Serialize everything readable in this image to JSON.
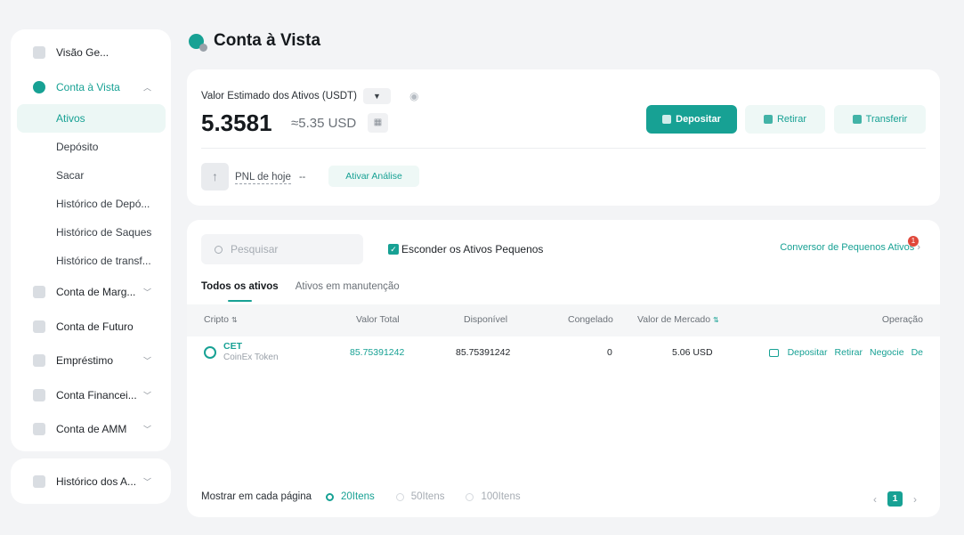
{
  "sidebar": {
    "items": [
      {
        "label": "Visão Ge...",
        "icon": "overview-icon"
      },
      {
        "label": "Conta à Vista",
        "icon": "spot-account-icon",
        "active": true,
        "expanded": true
      },
      {
        "label": "Conta de Marg...",
        "icon": "margin-icon"
      },
      {
        "label": "Conta de Futuro",
        "icon": "futures-icon"
      },
      {
        "label": "Empréstimo",
        "icon": "loan-icon"
      },
      {
        "label": "Conta Financei...",
        "icon": "financial-icon"
      },
      {
        "label": "Conta de AMM",
        "icon": "amm-icon"
      }
    ],
    "subitems": [
      "Ativos",
      "Depósito",
      "Sacar",
      "Histórico de Depó...",
      "Histórico de Saques",
      "Histórico de transf..."
    ],
    "history": "Histórico dos A..."
  },
  "page_title": "Conta à Vista",
  "summary": {
    "est_label": "Valor Estimado dos Ativos (USDT)",
    "value": "5.3581",
    "approx": "≈5.35 USD",
    "deposit": "Depositar",
    "withdraw": "Retirar",
    "transfer": "Transferir",
    "pnl_label": "PNL de hoje",
    "pnl_value": "--",
    "activate": "Ativar Análise"
  },
  "assets": {
    "search_placeholder": "Pesquisar",
    "hide_small": "Esconder os Ativos Pequenos",
    "converter": "Conversor de Pequenos Ativos",
    "converter_badge": "1",
    "tabs": [
      "Todos os ativos",
      "Ativos em manutenção"
    ],
    "columns": [
      "Cripto",
      "Valor Total",
      "Disponível",
      "Congelado",
      "Valor de Mercado",
      "Operação"
    ],
    "rows": [
      {
        "coin": "CET",
        "name": "CoinEx Token",
        "total": "85.75391242",
        "available": "85.75391242",
        "frozen": "0",
        "market": "5.06 USD",
        "ops": [
          "Depositar",
          "Retirar",
          "Negocie",
          "De"
        ]
      }
    ],
    "footer": {
      "per_page_label": "Mostrar em cada página",
      "options": [
        "20Itens",
        "50Itens",
        "100Itens"
      ],
      "page": "1"
    }
  },
  "colors": {
    "accent": "#17a194",
    "badge": "#e0483b"
  }
}
